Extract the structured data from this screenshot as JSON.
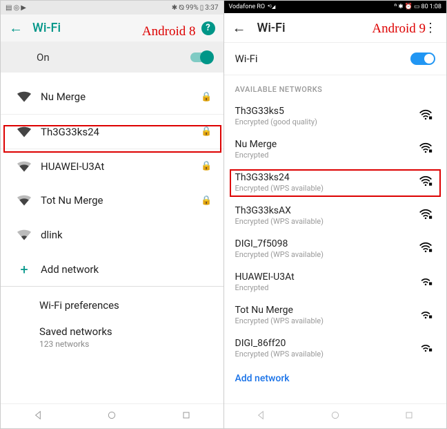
{
  "left": {
    "version_label": "Android 8",
    "status": {
      "battery": "99%",
      "time": "3:37"
    },
    "title": "Wi-Fi",
    "on_label": "On",
    "networks": [
      {
        "name": "Nu Merge",
        "strength": 3,
        "locked": true
      },
      {
        "name": "Th3G33ks24",
        "strength": 4,
        "locked": true
      },
      {
        "name": "HUAWEI-U3At",
        "strength": 2,
        "locked": true
      },
      {
        "name": "Tot Nu Merge",
        "strength": 2,
        "locked": true
      },
      {
        "name": "dlink",
        "strength": 1,
        "locked": false
      }
    ],
    "add_label": "Add network",
    "prefs_label": "Wi-Fi preferences",
    "saved_label": "Saved networks",
    "saved_sub": "123 networks"
  },
  "right": {
    "version_label": "Android 9",
    "status": {
      "carrier": "Vodafone RO",
      "battery": "80",
      "time": "1:08"
    },
    "title": "Wi-Fi",
    "wifi_label": "Wi-Fi",
    "section_label": "AVAILABLE NETWORKS",
    "networks": [
      {
        "name": "Th3G33ks5",
        "sub": "Encrypted (good quality)",
        "locked": true
      },
      {
        "name": "Nu Merge",
        "sub": "Encrypted",
        "locked": true
      },
      {
        "name": "Th3G33ks24",
        "sub": "Encrypted (WPS available)",
        "locked": true
      },
      {
        "name": "Th3G33ksAX",
        "sub": "Encrypted (WPS available)",
        "locked": true
      },
      {
        "name": "DIGI_7f5098",
        "sub": "Encrypted (WPS available)",
        "locked": true
      },
      {
        "name": "HUAWEI-U3At",
        "sub": "Encrypted",
        "locked": true
      },
      {
        "name": "Tot Nu Merge",
        "sub": "Encrypted (WPS available)",
        "locked": true
      },
      {
        "name": "DIGI_86ff20",
        "sub": "Encrypted (WPS available)",
        "locked": true
      }
    ],
    "add_label": "Add network"
  }
}
